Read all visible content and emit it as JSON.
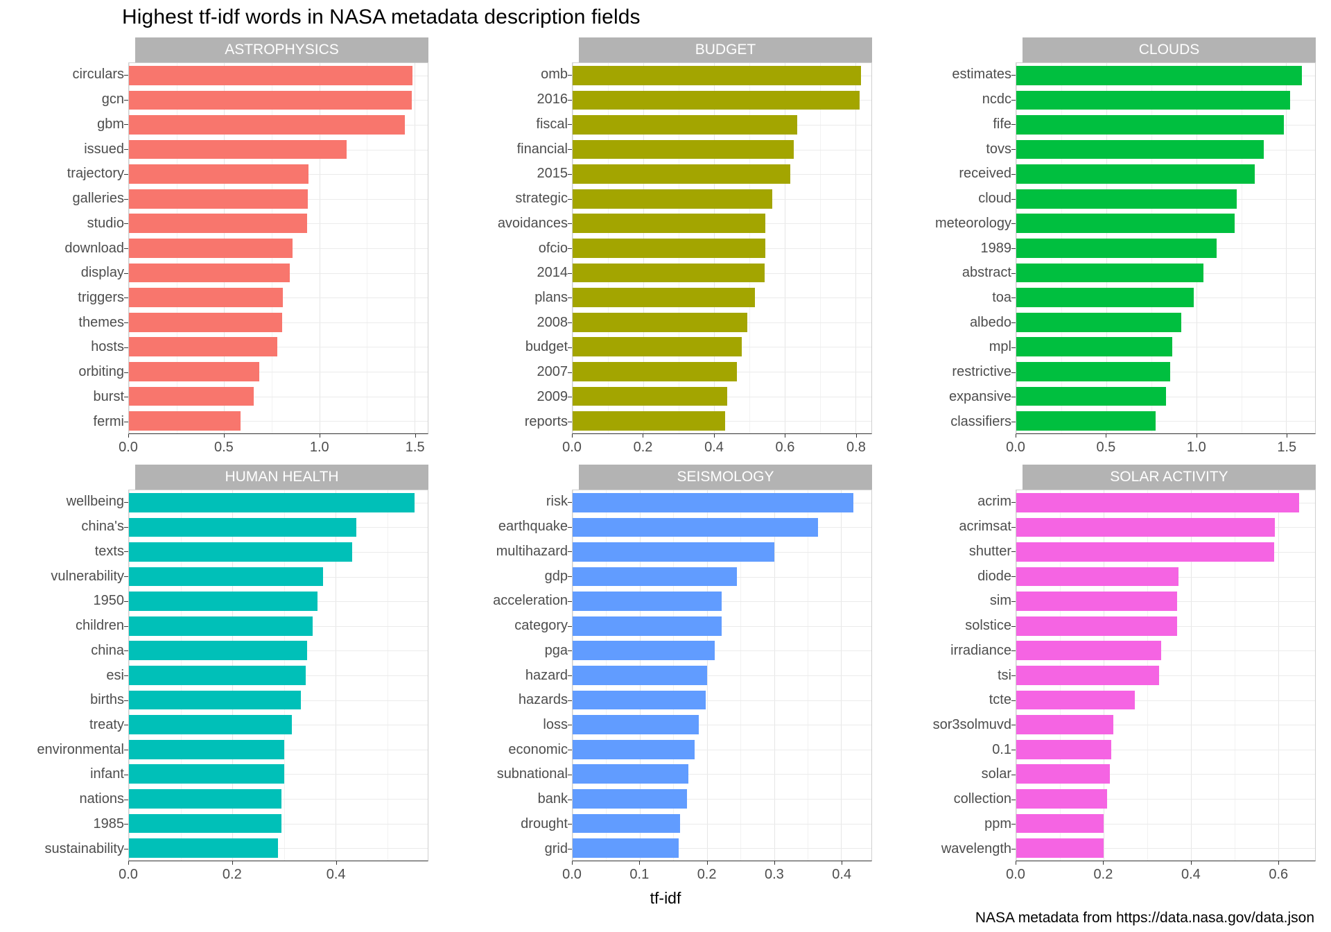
{
  "chart_data": {
    "type": "bar",
    "title": "Highest tf-idf words in NASA metadata description fields",
    "xlabel": "tf-idf",
    "ylabel": "",
    "caption": "NASA metadata from https://data.nasa.gov/data.json",
    "orientation": "horizontal",
    "grid": true,
    "legend": "none",
    "facets": [
      {
        "label": "ASTROPHYSICS",
        "color": "#f8766d",
        "xlim": [
          0,
          1.57
        ],
        "ticks": [
          0.0,
          0.5,
          1.0,
          1.5
        ],
        "tick_labels": [
          "0.0",
          "0.5",
          "1.0",
          "1.5"
        ],
        "minor_ticks": [
          0.25,
          0.75,
          1.25
        ],
        "categories": [
          "circulars",
          "gcn",
          "gbm",
          "issued",
          "trajectory",
          "galleries",
          "studio",
          "download",
          "display",
          "triggers",
          "themes",
          "hosts",
          "orbiting",
          "burst",
          "fermi"
        ],
        "values": [
          1.49,
          1.485,
          1.45,
          1.145,
          0.945,
          0.94,
          0.935,
          0.86,
          0.845,
          0.81,
          0.805,
          0.78,
          0.685,
          0.655,
          0.585
        ]
      },
      {
        "label": "BUDGET",
        "color": "#a3a500",
        "xlim": [
          0,
          0.845
        ],
        "ticks": [
          0.0,
          0.2,
          0.4,
          0.6,
          0.8
        ],
        "tick_labels": [
          "0.0",
          "0.2",
          "0.4",
          "0.6",
          "0.8"
        ],
        "minor_ticks": [
          0.1,
          0.3,
          0.5,
          0.7
        ],
        "categories": [
          "omb",
          "2016",
          "fiscal",
          "financial",
          "2015",
          "strategic",
          "avoidances",
          "ofcio",
          "2014",
          "plans",
          "2008",
          "budget",
          "2007",
          "2009",
          "reports"
        ],
        "values": [
          0.815,
          0.812,
          0.635,
          0.625,
          0.615,
          0.565,
          0.545,
          0.545,
          0.543,
          0.515,
          0.495,
          0.478,
          0.465,
          0.438,
          0.432
        ]
      },
      {
        "label": "CLOUDS",
        "color": "#00bf3f",
        "xlim": [
          0,
          1.66
        ],
        "ticks": [
          0.0,
          0.5,
          1.0,
          1.5
        ],
        "tick_labels": [
          "0.0",
          "0.5",
          "1.0",
          "1.5"
        ],
        "minor_ticks": [
          0.25,
          0.75,
          1.25
        ],
        "categories": [
          "estimates",
          "ncdc",
          "fife",
          "tovs",
          "received",
          "cloud",
          "meteorology",
          "1989",
          "abstract",
          "toa",
          "albedo",
          "mpl",
          "restrictive",
          "expansive",
          "classifiers"
        ],
        "values": [
          1.585,
          1.52,
          1.485,
          1.375,
          1.325,
          1.225,
          1.215,
          1.115,
          1.04,
          0.985,
          0.915,
          0.865,
          0.855,
          0.83,
          0.775
        ]
      },
      {
        "label": "HUMAN HEALTH",
        "color": "#00c0b8",
        "xlim": [
          0,
          0.578
        ],
        "ticks": [
          0.0,
          0.2,
          0.4
        ],
        "tick_labels": [
          "0.0",
          "0.2",
          "0.4"
        ],
        "minor_ticks": [
          0.1,
          0.3,
          0.5
        ],
        "categories": [
          "wellbeing",
          "china's",
          "texts",
          "vulnerability",
          "1950",
          "children",
          "china",
          "esi",
          "births",
          "treaty",
          "environmental",
          "infant",
          "nations",
          "1985",
          "sustainability"
        ],
        "values": [
          0.552,
          0.44,
          0.432,
          0.375,
          0.365,
          0.355,
          0.345,
          0.342,
          0.332,
          0.315,
          0.3,
          0.3,
          0.295,
          0.295,
          0.288
        ]
      },
      {
        "label": "SEISMOLOGY",
        "color": "#619cff",
        "xlim": [
          0,
          0.445
        ],
        "ticks": [
          0.0,
          0.1,
          0.2,
          0.3,
          0.4
        ],
        "tick_labels": [
          "0.0",
          "0.1",
          "0.2",
          "0.3",
          "0.4"
        ],
        "minor_ticks": [
          0.05,
          0.15,
          0.25,
          0.35
        ],
        "categories": [
          "risk",
          "earthquake",
          "multihazard",
          "gdp",
          "acceleration",
          "category",
          "pga",
          "hazard",
          "hazards",
          "loss",
          "economic",
          "subnational",
          "bank",
          "drought",
          "grid"
        ],
        "values": [
          0.418,
          0.365,
          0.3,
          0.245,
          0.222,
          0.222,
          0.212,
          0.2,
          0.198,
          0.188,
          0.182,
          0.172,
          0.17,
          0.16,
          0.158
        ]
      },
      {
        "label": "SOLAR ACTIVITY",
        "color": "#f564e3",
        "xlim": [
          0,
          0.685
        ],
        "ticks": [
          0.0,
          0.2,
          0.4,
          0.6
        ],
        "tick_labels": [
          "0.0",
          "0.2",
          "0.4",
          "0.6"
        ],
        "minor_ticks": [
          0.1,
          0.3,
          0.5
        ],
        "categories": [
          "acrim",
          "acrimsat",
          "shutter",
          "diode",
          "sim",
          "solstice",
          "irradiance",
          "tsi",
          "tcte",
          "sor3solmuvd",
          "0.1",
          "solar",
          "collection",
          "ppm",
          "wavelength"
        ],
        "values": [
          0.648,
          0.593,
          0.592,
          0.372,
          0.368,
          0.368,
          0.332,
          0.328,
          0.272,
          0.222,
          0.218,
          0.215,
          0.208,
          0.2,
          0.2
        ]
      }
    ]
  }
}
